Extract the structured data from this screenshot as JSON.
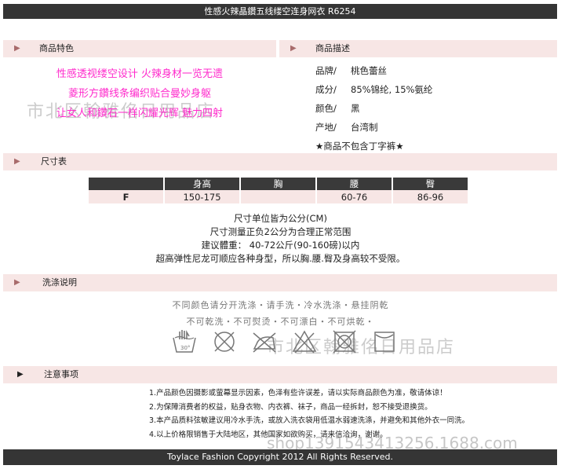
{
  "header": {
    "title": "性感火辣晶鑽五线缕空连身网衣  R6254"
  },
  "sections": {
    "features": "商品特色",
    "description": "商品描述",
    "size": "尺寸表",
    "wash": "洗涤说明",
    "caution": "注意事项"
  },
  "features": [
    "性感透视缕空设计 火辣身材一览无遗",
    "菱形方鑽线条编织贴合曼妙身躯",
    "让女人和鑽石一样闪耀光辉 魅力四射"
  ],
  "description": {
    "rows": [
      {
        "k": "品牌/",
        "v": "桃色蕾丝"
      },
      {
        "k": "成分/",
        "v": "85%锦纶, 15%氨纶"
      },
      {
        "k": "颜色/",
        "v": "黑"
      },
      {
        "k": "产地/",
        "v": "台湾制"
      }
    ],
    "note": "★商品不包含丁字裤★"
  },
  "size_table": {
    "headers": [
      "",
      "身高",
      "胸",
      "腰",
      "臀"
    ],
    "rows": [
      [
        "F",
        "150-175",
        "",
        "60-76",
        "86-96"
      ]
    ]
  },
  "size_notes": [
    "尺寸单位皆为公分(CM)",
    "尺寸测量正负2公分为合理正常范围",
    "建议體重： 40-72公斤(90-160磅)以内",
    "超高弹性尼龙可顺应各种身型，所以胸.腰.臀及身高较不受限。"
  ],
  "wash": {
    "line1": "不同颜色请分开洗涤・请手洗・冷水洗涤・悬挂阴乾",
    "line2": "不可乾洗・不可熨烫・不可漂白・不可烘乾・",
    "icons": [
      "hand-wash-30-icon",
      "no-dry-clean-icon",
      "no-iron-icon",
      "no-bleach-icon",
      "no-tumble-dry-icon",
      "hang-dry-icon"
    ],
    "temp": "30°"
  },
  "caution": [
    "1.产品颜色因摄影或萤幕显示因素，色泽有些许误差，请以实际商品颜色为准，敬请体谅！",
    "2.为保障消费者的权益，贴身衣物、内衣裤、袜子，商品一经拆封，恕不接受退换货。",
    "3.本产品质料弦敏建议用冷水手洗，或放入洗衣袋用低温水弱速洗涤，并避免和其他外衣一同洗。",
    "4.以上价格限销售于大陆地区，其他国家如欲购买，请来信洽询，谢谢。"
  ],
  "watermarks": {
    "store1": "市北区翰雅佲日用品店",
    "store2": "市北区翰雅佲日用品店",
    "url": "shop1391543413256.1688.com"
  },
  "footer": {
    "copyright": "Toylace Fashion Copyright 2012 All Rights Reserved."
  }
}
